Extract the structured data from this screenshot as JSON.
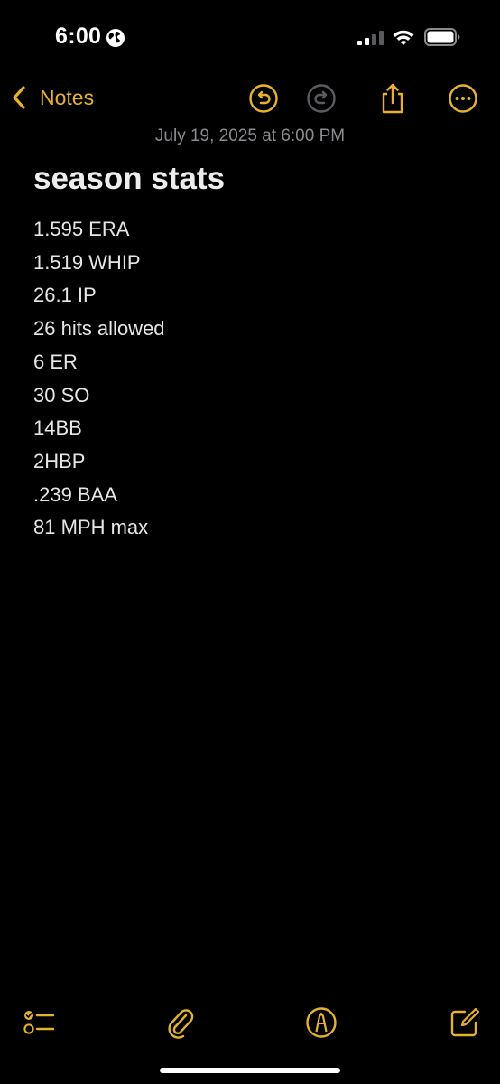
{
  "status_bar": {
    "time": "6:00",
    "icons": [
      "globe-icon",
      "cellular-signal-icon",
      "wifi-icon",
      "battery-icon"
    ]
  },
  "nav": {
    "back_label": "Notes",
    "icons": [
      "undo-icon",
      "redo-icon",
      "share-icon",
      "more-icon"
    ]
  },
  "note": {
    "date": "July 19, 2025 at 6:00 PM",
    "title": "season stats",
    "lines": [
      "1.595 ERA",
      "1.519 WHIP",
      "26.1 IP",
      "26 hits allowed",
      "6 ER",
      "30 SO",
      "14BB",
      "2HBP",
      ".239 BAA",
      "81 MPH max"
    ]
  },
  "toolbar": {
    "icons": [
      "checklist-icon",
      "paperclip-icon",
      "markup-icon",
      "compose-icon"
    ]
  },
  "colors": {
    "accent": "#e6b22d",
    "background": "#000000",
    "date_text": "#8c8c90",
    "disabled_icon": "#8a8a8e"
  }
}
